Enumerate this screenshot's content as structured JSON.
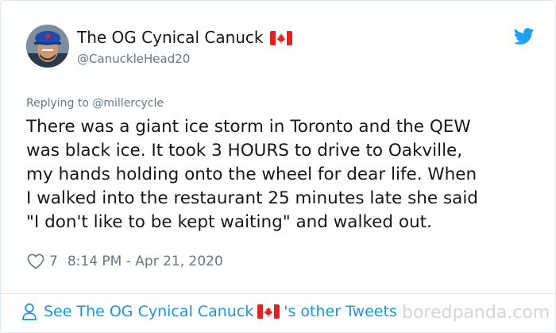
{
  "tweet": {
    "author": {
      "display_name": "The OG Cynical Canuck",
      "handle": "@CanuckleHead20",
      "flag_icon": "canada-flag-icon"
    },
    "reply_prefix": "Replying to ",
    "reply_to": "@millercycle",
    "text": "There was a giant ice storm in Toronto and the QEW\nwas black ice. It took 3 HOURS to drive to Oakville,\nmy hands holding onto the wheel for dear life. When\nI walked into the restaurant 25 minutes late she said\n\"I don't like to be kept waiting\" and walked out.",
    "likes": "7",
    "timestamp": "8:14 PM - Apr 21, 2020"
  },
  "footer": {
    "prefix": "See The OG Cynical Canuck ",
    "suffix": "'s other Tweets"
  },
  "watermark": "boredpanda.com",
  "colors": {
    "twitter_blue": "#1da1f2",
    "link_blue": "#1b95e0",
    "muted": "#657786",
    "text": "#14171a",
    "flag_red": "#e0231f"
  }
}
